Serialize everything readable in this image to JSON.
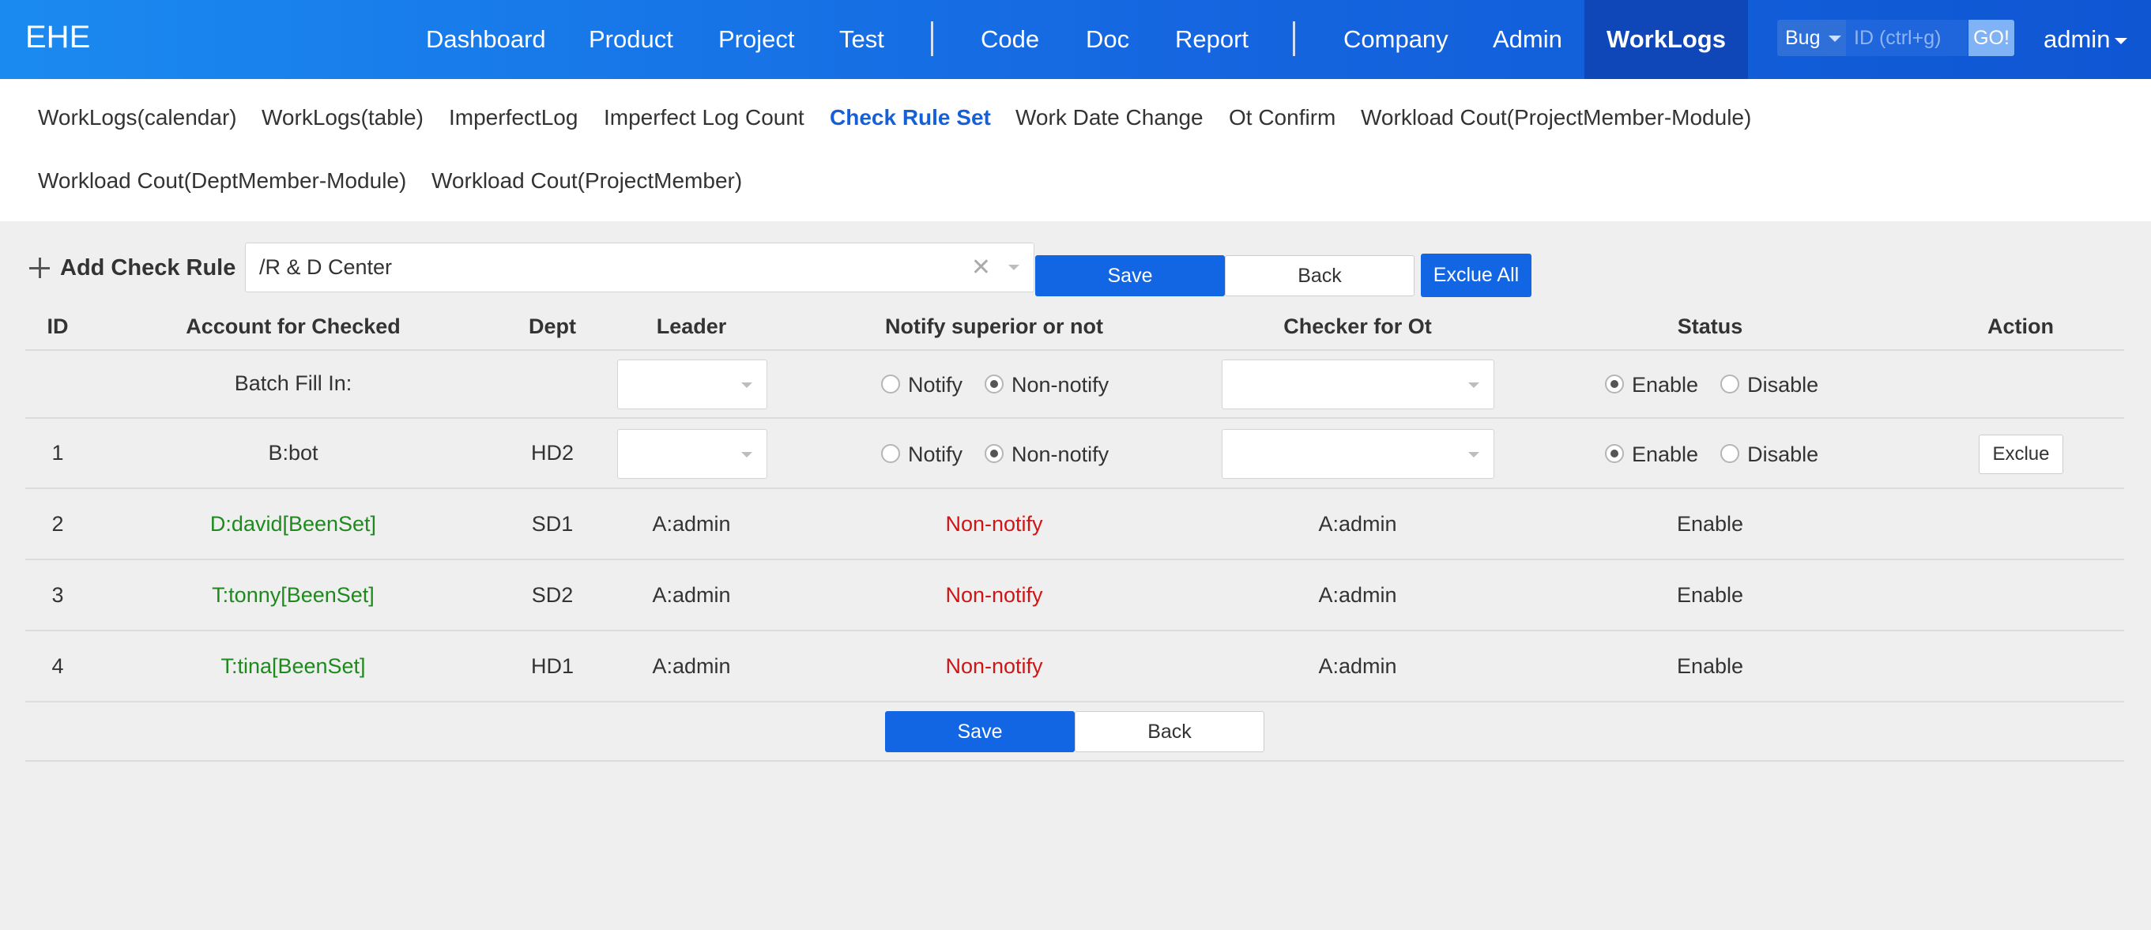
{
  "app": {
    "brand": "EHE"
  },
  "topnav": {
    "group1": [
      "Dashboard",
      "Product",
      "Project",
      "Test"
    ],
    "group2": [
      "Code",
      "Doc",
      "Report"
    ],
    "group3": [
      "Company",
      "Admin",
      "WorkLogs"
    ],
    "active": "WorkLogs",
    "search": {
      "type": "Bug",
      "placeholder": "ID (ctrl+g)",
      "go": "GO!"
    },
    "user": "admin"
  },
  "subnav": {
    "items": [
      "WorkLogs(calendar)",
      "WorkLogs(table)",
      "ImperfectLog",
      "Imperfect Log Count",
      "Check Rule Set",
      "Work Date Change",
      "Ot Confirm",
      "Workload Cout(ProjectMember-Module)",
      "Workload Cout(DeptMember-Module)",
      "Workload Cout(ProjectMember)"
    ],
    "active": "Check Rule Set"
  },
  "toolbar": {
    "title": "Add Check Rule",
    "dept_value": "/R & D Center",
    "save": "Save",
    "back": "Back",
    "exclude_all": "Exclue All"
  },
  "table": {
    "headers": {
      "id": "ID",
      "account": "Account for Checked",
      "dept": "Dept",
      "leader": "Leader",
      "notify": "Notify superior or not",
      "checker": "Checker for Ot",
      "status": "Status",
      "action": "Action"
    },
    "batch": {
      "label": "Batch Fill In:",
      "notify_options": [
        "Notify",
        "Non-notify"
      ],
      "notify_selected": "Non-notify",
      "status_options": [
        "Enable",
        "Disable"
      ],
      "status_selected": "Enable"
    },
    "editable_row": {
      "id": "1",
      "account": "B:bot",
      "dept": "HD2",
      "notify_options": [
        "Notify",
        "Non-notify"
      ],
      "notify_selected": "Non-notify",
      "status_options": [
        "Enable",
        "Disable"
      ],
      "status_selected": "Enable",
      "action": "Exclue"
    },
    "rows": [
      {
        "id": "2",
        "account": "D:david[BeenSet]",
        "dept": "SD1",
        "leader": "A:admin",
        "notify": "Non-notify",
        "checker": "A:admin",
        "status": "Enable"
      },
      {
        "id": "3",
        "account": "T:tonny[BeenSet]",
        "dept": "SD2",
        "leader": "A:admin",
        "notify": "Non-notify",
        "checker": "A:admin",
        "status": "Enable"
      },
      {
        "id": "4",
        "account": "T:tina[BeenSet]",
        "dept": "HD1",
        "leader": "A:admin",
        "notify": "Non-notify",
        "checker": "A:admin",
        "status": "Enable"
      }
    ],
    "footer": {
      "save": "Save",
      "back": "Back"
    }
  },
  "colors": {
    "nav_gradient_start": "#1a8af0",
    "nav_gradient_end": "#0f56d3",
    "active_nav": "#1047b8",
    "primary": "#1266e3",
    "set_account": "#1e8a1e",
    "non_notify": "#d11414"
  }
}
